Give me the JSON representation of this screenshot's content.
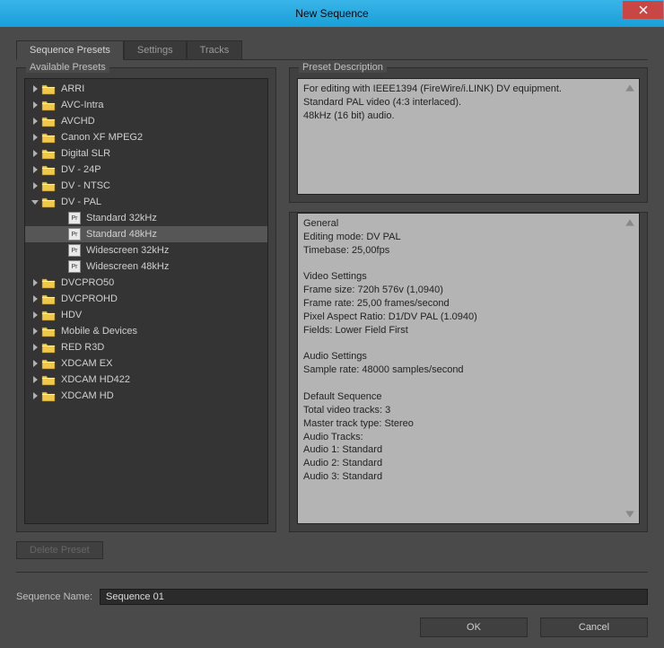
{
  "window": {
    "title": "New Sequence"
  },
  "tabs": {
    "sequence_presets": "Sequence Presets",
    "settings": "Settings",
    "tracks": "Tracks"
  },
  "left_panel": {
    "title": "Available Presets",
    "folders": [
      {
        "label": "ARRI",
        "expanded": false
      },
      {
        "label": "AVC-Intra",
        "expanded": false
      },
      {
        "label": "AVCHD",
        "expanded": false
      },
      {
        "label": "Canon XF MPEG2",
        "expanded": false
      },
      {
        "label": "Digital SLR",
        "expanded": false
      },
      {
        "label": "DV - 24P",
        "expanded": false
      },
      {
        "label": "DV - NTSC",
        "expanded": false
      },
      {
        "label": "DV - PAL",
        "expanded": true,
        "children": [
          {
            "label": "Standard 32kHz",
            "selected": false
          },
          {
            "label": "Standard 48kHz",
            "selected": true
          },
          {
            "label": "Widescreen 32kHz",
            "selected": false
          },
          {
            "label": "Widescreen 48kHz",
            "selected": false
          }
        ]
      },
      {
        "label": "DVCPRO50",
        "expanded": false
      },
      {
        "label": "DVCPROHD",
        "expanded": false
      },
      {
        "label": "HDV",
        "expanded": false
      },
      {
        "label": "Mobile & Devices",
        "expanded": false
      },
      {
        "label": "RED R3D",
        "expanded": false
      },
      {
        "label": "XDCAM EX",
        "expanded": false
      },
      {
        "label": "XDCAM HD422",
        "expanded": false
      },
      {
        "label": "XDCAM HD",
        "expanded": false
      }
    ],
    "delete_button": "Delete Preset"
  },
  "right_panel": {
    "title": "Preset Description",
    "desc_line1": "For editing with IEEE1394 (FireWire/i.LINK) DV equipment.",
    "desc_line2": "Standard PAL video (4:3 interlaced).",
    "desc_line3": "48kHz (16 bit) audio.",
    "details": {
      "h_general": "General",
      "editing_mode": " Editing mode: DV PAL",
      "timebase": " Timebase: 25,00fps",
      "h_video": "Video Settings",
      "frame_size": " Frame size: 720h 576v (1,0940)",
      "frame_rate": " Frame rate: 25,00 frames/second",
      "par": " Pixel Aspect Ratio: D1/DV PAL (1.0940)",
      "fields": " Fields: Lower Field First",
      "h_audio": "Audio Settings",
      "sample_rate": " Sample rate: 48000 samples/second",
      "h_default": "Default Sequence",
      "total_video": " Total video tracks: 3",
      "master_track": " Master track type: Stereo",
      "audio_tracks": " Audio Tracks:",
      "a1": " Audio 1: Standard",
      "a2": " Audio 2: Standard",
      "a3": " Audio 3: Standard"
    }
  },
  "sequence_name": {
    "label": "Sequence Name:",
    "value": "Sequence 01"
  },
  "buttons": {
    "ok": "OK",
    "cancel": "Cancel"
  },
  "colors": {
    "accent": "#29a3dc",
    "folder": "#f0c84a"
  }
}
